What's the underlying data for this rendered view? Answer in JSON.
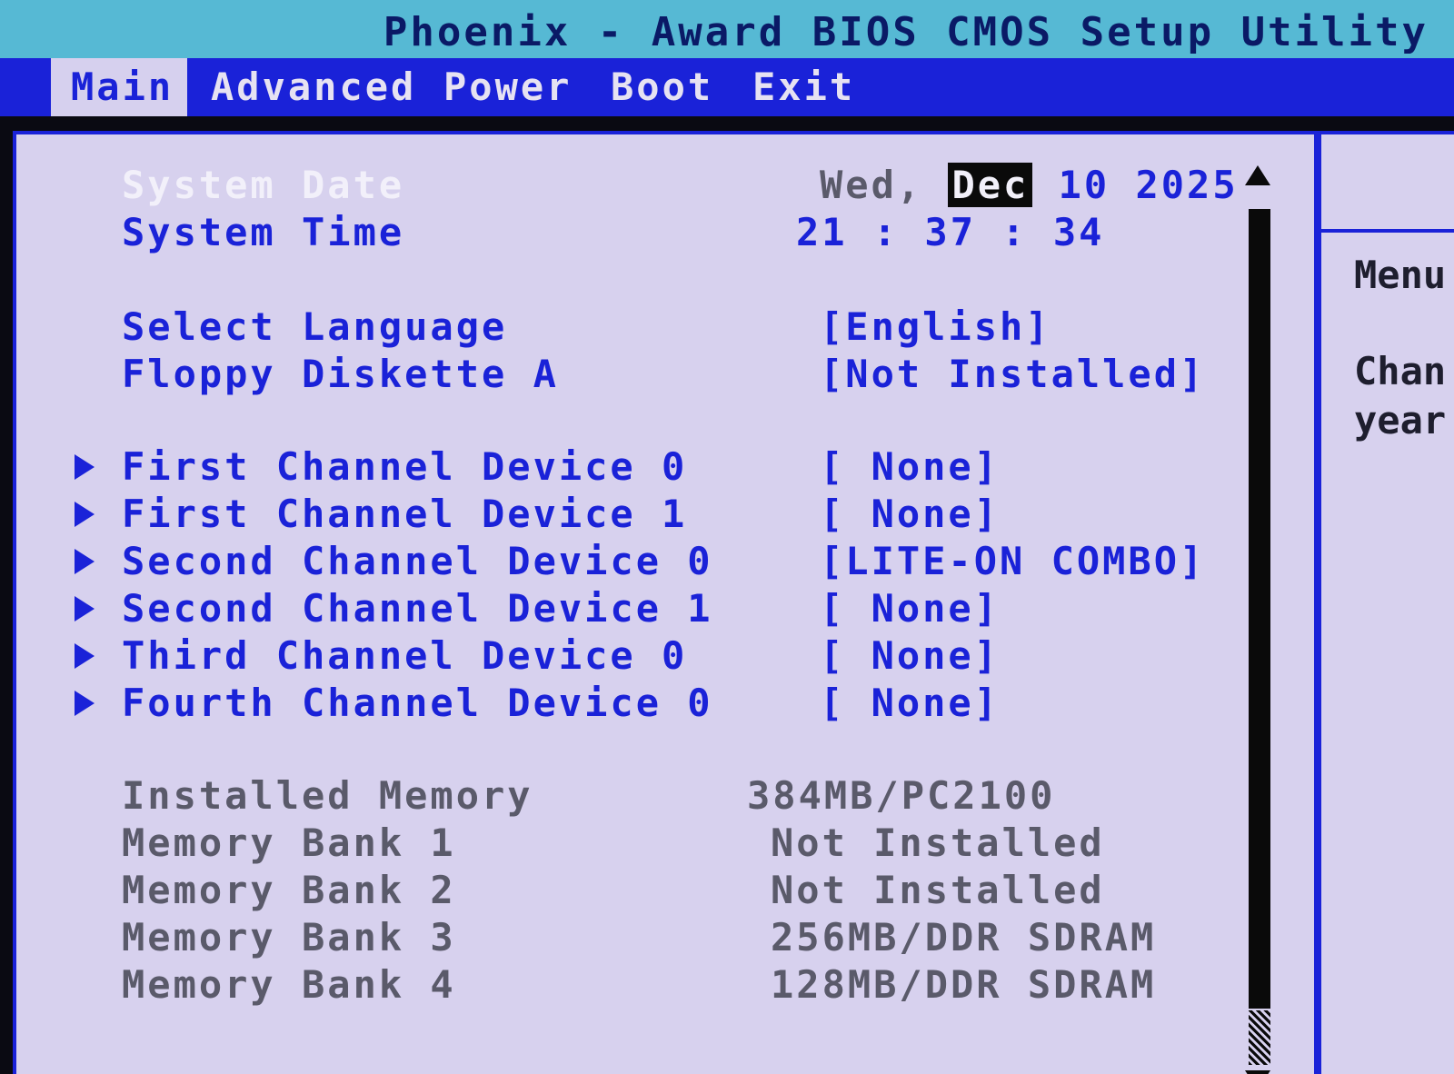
{
  "window": {
    "title": "Phoenix - Award BIOS CMOS Setup Utility"
  },
  "menu": [
    {
      "label": "Main",
      "active": true
    },
    {
      "label": "Advanced",
      "active": false
    },
    {
      "label": "Power",
      "active": false
    },
    {
      "label": "Boot",
      "active": false
    },
    {
      "label": "Exit",
      "active": false
    }
  ],
  "system": {
    "date_label": "System Date",
    "date_day": "Wed,",
    "date_month": "Dec",
    "date_rest": "10 2025",
    "time_label": "System Time",
    "time_value": "21 : 37 : 34"
  },
  "settings": {
    "language_label": "Select Language",
    "language_value": "[English]",
    "floppy_label": "Floppy Diskette A",
    "floppy_value": "[Not Installed]"
  },
  "devices": [
    {
      "label": "First Channel Device 0",
      "value": "[ None]"
    },
    {
      "label": "First Channel Device 1",
      "value": "[ None]"
    },
    {
      "label": "Second Channel Device 0",
      "value": "[LITE-ON COMBO]"
    },
    {
      "label": "Second Channel Device 1",
      "value": "[ None]"
    },
    {
      "label": "Third Channel Device 0",
      "value": "[ None]"
    },
    {
      "label": "Fourth Channel Device 0",
      "value": "[ None]"
    }
  ],
  "memory": [
    {
      "label": "Installed Memory",
      "value": "384MB/PC2100"
    },
    {
      "label": "Memory Bank 1",
      "value": "Not Installed"
    },
    {
      "label": "Memory Bank 2",
      "value": "Not Installed"
    },
    {
      "label": "Memory Bank 3",
      "value": "256MB/DDR SDRAM"
    },
    {
      "label": "Memory Bank 4",
      "value": "128MB/DDR SDRAM"
    }
  ],
  "help": {
    "line1": "Menu",
    "line2": "Chan",
    "line3": "year"
  },
  "colors": {
    "title_bar": "#56b9d4",
    "menu_bar": "#1a22d8",
    "panel_bg": "#d7d1ee",
    "accent": "#1a22d8"
  }
}
